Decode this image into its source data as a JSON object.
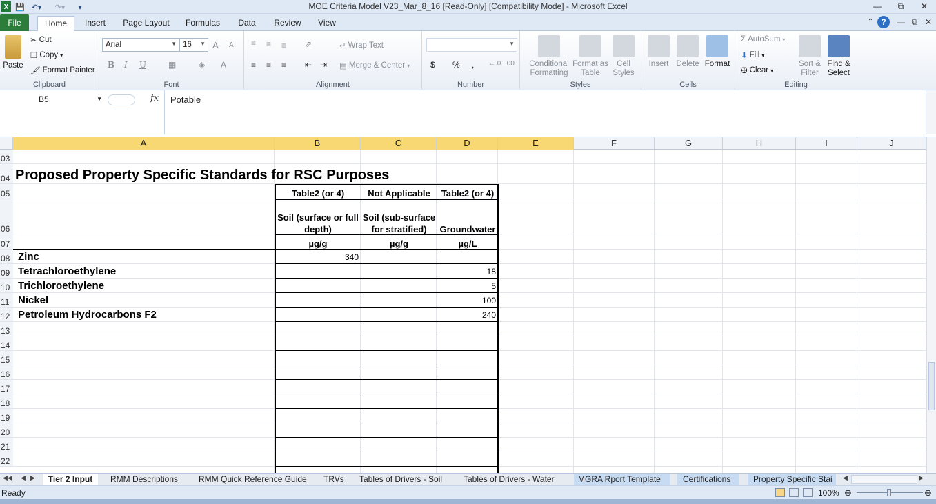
{
  "window": {
    "title": "MOE Criteria Model V23_Mar_8_16  [Read-Only]  [Compatibility Mode]  -  Microsoft Excel"
  },
  "ribbon_tabs": [
    "File",
    "Home",
    "Insert",
    "Page Layout",
    "Formulas",
    "Data",
    "Review",
    "View"
  ],
  "clipboard": {
    "paste": "Paste",
    "cut": "Cut",
    "copy": "Copy",
    "format_painter": "Format Painter",
    "label": "Clipboard"
  },
  "font": {
    "name": "Arial",
    "size": "16",
    "label": "Font",
    "bold": "B",
    "italic": "I",
    "underline": "U",
    "grow": "A",
    "shrink": "A"
  },
  "alignment": {
    "wrap_text": "Wrap Text",
    "merge_center": "Merge & Center",
    "label": "Alignment"
  },
  "number": {
    "format_value": "",
    "currency": "$",
    "percent": "%",
    "comma": ",",
    "label": "Number"
  },
  "styles": {
    "conditional": "Conditional Formatting",
    "format_table": "Format as Table",
    "cell_styles": "Cell Styles",
    "label": "Styles"
  },
  "cells_group": {
    "insert": "Insert",
    "delete": "Delete",
    "format": "Format",
    "label": "Cells"
  },
  "editing": {
    "autosum": "AutoSum",
    "fill": "Fill",
    "clear": "Clear",
    "sort_filter": "Sort & Filter",
    "find_select": "Find & Select",
    "label": "Editing"
  },
  "formula_bar": {
    "name_box": "B5",
    "fx": "fx",
    "value": "Potable"
  },
  "columns": [
    "A",
    "B",
    "C",
    "D",
    "E",
    "F",
    "G",
    "H",
    "I",
    "J"
  ],
  "rows": [
    "03",
    "04",
    "05",
    "06",
    "07",
    "08",
    "09",
    "10",
    "11",
    "12",
    "13",
    "14",
    "15",
    "16",
    "17",
    "18",
    "19",
    "20",
    "21",
    "22"
  ],
  "sheet": {
    "title": "Proposed Property Specific Standards for RSC Purposes",
    "headers": {
      "b5": "Table2 (or 4)",
      "c5": "Not Applicable",
      "d5": "Table2 (or 4)",
      "b6_line1": "Soil (surface or full",
      "b6_line2": "depth)",
      "c6_line1": "Soil (sub-surface",
      "c6_line2": "for stratified)",
      "d6": "Groundwater",
      "b7": "µg/g",
      "c7": "µg/g",
      "d7": "µg/L"
    },
    "data_rows": [
      {
        "name": "Zinc",
        "b": "340",
        "c": "",
        "d": ""
      },
      {
        "name": "Tetrachloroethylene",
        "b": "",
        "c": "",
        "d": "18"
      },
      {
        "name": "Trichloroethylene",
        "b": "",
        "c": "",
        "d": "5"
      },
      {
        "name": "Nickel",
        "b": "",
        "c": "",
        "d": "100"
      },
      {
        "name": "Petroleum Hydrocarbons F2",
        "b": "",
        "c": "",
        "d": "240"
      }
    ]
  },
  "sheet_tabs": [
    "Tier 2 Input",
    "RMM Descriptions",
    "RMM Quick Reference Guide",
    "TRVs",
    "Tables of Drivers - Soil",
    "Tables of Drivers - Water",
    "MGRA Rport Template",
    "Certifications",
    "Property Specific Stai"
  ],
  "status": {
    "ready": "Ready",
    "zoom": "100%"
  }
}
